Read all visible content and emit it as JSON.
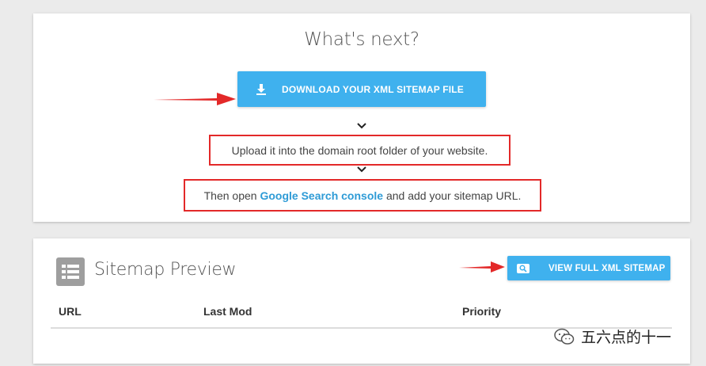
{
  "next_card": {
    "title": "What's next?",
    "download_button": {
      "label": "DOWNLOAD YOUR XML SITEMAP FILE",
      "icon": "download-icon"
    },
    "step1": "Upload it into the domain root folder of your website.",
    "step2": {
      "prefix": "Then open ",
      "link": "Google Search console",
      "suffix": " and add your sitemap URL."
    }
  },
  "preview_card": {
    "title": "Sitemap Preview",
    "icon": "list-icon",
    "view_button": {
      "label": "VIEW FULL XML SITEMAP",
      "icon": "search-icon"
    },
    "columns": [
      "URL",
      "Last Mod",
      "Priority"
    ]
  },
  "watermark": {
    "text": "五六点的十一"
  },
  "colors": {
    "accent": "#3fb1ee",
    "annotation_red": "#e32929",
    "link": "#2e9bd6",
    "background": "#ebebeb"
  }
}
